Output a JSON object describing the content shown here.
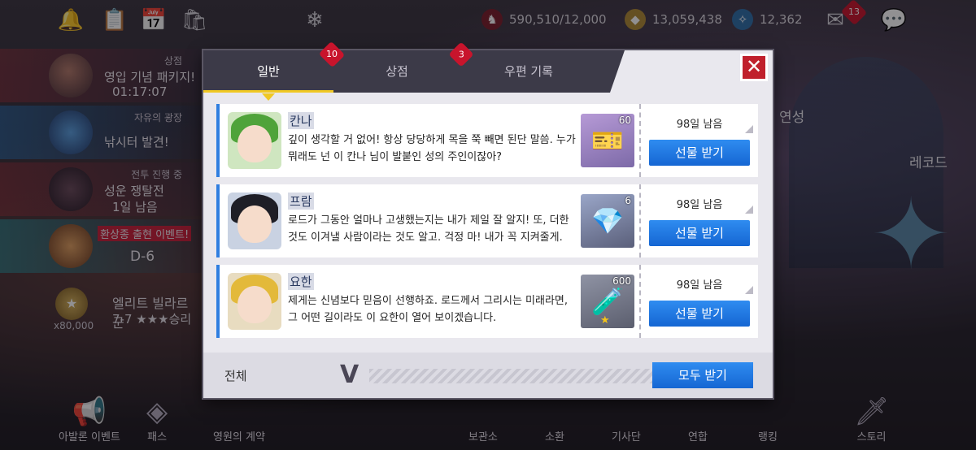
{
  "hud": {
    "stamina": "590,510/12,000",
    "gold": "13,059,438",
    "crystal": "12,362",
    "mail_count": "13"
  },
  "left_events": [
    {
      "category": "상점",
      "title": "영입 기념 패키지!",
      "sub": "01:17:07"
    },
    {
      "category": "자유의 광장",
      "title": "낚시터 발견!",
      "sub": ""
    },
    {
      "category": "전투 진행 중",
      "title": "성운 쟁탈전",
      "sub": "1일 남음"
    },
    {
      "category": "",
      "title": "환상종 출현 이벤트!",
      "sub": "D-6"
    }
  ],
  "elite": {
    "title": "엘리트 빌라르 군",
    "stage": "7-7 ★★★승리",
    "cost": "x80,000"
  },
  "right_labels": {
    "yeonseong": "연성",
    "record": "레코드"
  },
  "bottom_nav": [
    "아발론 이벤트",
    "패스",
    "영원의 계약",
    "보관소",
    "소환",
    "기사단",
    "연합",
    "랭킹",
    "스토리"
  ],
  "modal": {
    "tabs": [
      {
        "label": "일반",
        "badge": "10"
      },
      {
        "label": "상점",
        "badge": "3"
      },
      {
        "label": "우편 기록",
        "badge": ""
      }
    ],
    "close_label": "✕",
    "mails": [
      {
        "sender": "칸나",
        "message": "깊이 생각할 거 없어! 항상 당당하게 목을 쭉 빼면 된단 말씀. 누가 뭐래도 넌 이 칸나 님이 발붙인 성의 주인이잖아?",
        "item_qty": "60",
        "remaining": "98일 남음",
        "button": "선물 받기"
      },
      {
        "sender": "프람",
        "message": "로드가 그동안 얼마나 고생했는지는 내가 제일 잘 알지! 또, 더한 것도 이겨낼 사람이라는 것도 알고. 걱정 마! 내가 꼭 지켜줄게.",
        "item_qty": "6",
        "remaining": "98일 남음",
        "button": "선물 받기"
      },
      {
        "sender": "요한",
        "message": "제게는 신념보다 믿음이 선행하죠. 로드께서 그리시는 미래라면, 그 어떤 길이라도 이 요한이 열어 보이겠습니다.",
        "item_qty": "600",
        "remaining": "98일 남음",
        "button": "선물 받기"
      }
    ],
    "footer": {
      "filter_label": "전체",
      "claim_all": "모두 받기"
    }
  },
  "colors": {
    "accent_blue": "#1f78e6",
    "tab_underline": "#f0c824",
    "badge_red": "#c8142c"
  }
}
